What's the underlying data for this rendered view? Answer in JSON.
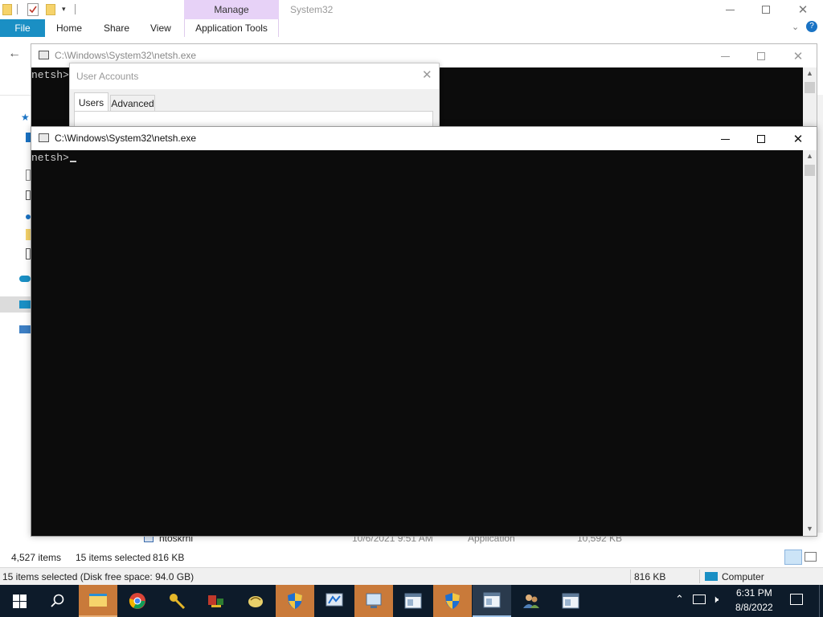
{
  "explorer": {
    "manage_tab": "Manage",
    "window_title": "System32",
    "ribbon_tabs": [
      "File",
      "Home",
      "Share",
      "View",
      "Application Tools"
    ],
    "file_row": {
      "name": "ntoskrnl",
      "date": "10/6/2021 9:51 AM",
      "type": "Application",
      "size": "10,592 KB"
    },
    "status_items": "4,527 items",
    "status_selected": "15 items selected",
    "status_size": "816 KB"
  },
  "bottom_status": {
    "left": "15 items selected (Disk free space: 94.0 GB)",
    "size": "816 KB",
    "location": "Computer"
  },
  "console_back": {
    "title": "C:\\Windows\\System32\\netsh.exe",
    "prompt": "netsh>"
  },
  "user_accounts": {
    "title": "User Accounts",
    "tabs": [
      "Users",
      "Advanced"
    ]
  },
  "console_front": {
    "title": "C:\\Windows\\System32\\netsh.exe",
    "prompt": "netsh>"
  },
  "taskbar": {
    "time": "6:31 PM",
    "date": "8/8/2022",
    "accent": "#0d1b2a",
    "highlight": "#c97a3a"
  }
}
